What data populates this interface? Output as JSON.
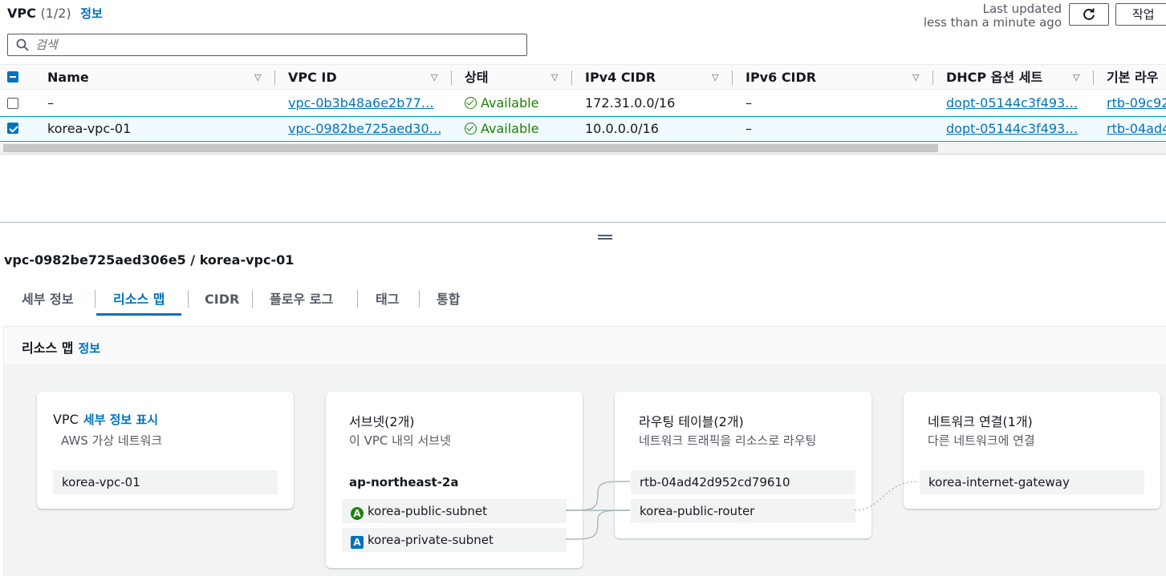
{
  "header": {
    "title": "VPC",
    "count": "(1/2)",
    "info_link": "정보",
    "last_updated_label": "Last updated",
    "last_updated_value": "less than a minute ago",
    "action_label": "작업",
    "refresh_icon": "refresh-icon"
  },
  "search": {
    "placeholder": "검색",
    "icon": "search-icon"
  },
  "table": {
    "columns": [
      "Name",
      "VPC ID",
      "상태",
      "IPv4 CIDR",
      "IPv6 CIDR",
      "DHCP 옵션 세트",
      "기본 라우"
    ],
    "rows": [
      {
        "selected": false,
        "name": "–",
        "vpc_id": "vpc-0b3b48a6e2b77…",
        "status": "Available",
        "ipv4": "172.31.0.0/16",
        "ipv6": "–",
        "dhcp": "dopt-05144c3f493…",
        "route": "rtb-09c92"
      },
      {
        "selected": true,
        "name": "korea-vpc-01",
        "vpc_id": "vpc-0982be725aed30…",
        "status": "Available",
        "ipv4": "10.0.0.0/16",
        "ipv6": "–",
        "dhcp": "dopt-05144c3f493…",
        "route": "rtb-04ad4"
      }
    ]
  },
  "detail": {
    "title": "vpc-0982be725aed306e5 / korea-vpc-01",
    "tabs": [
      "세부 정보",
      "리소스 맵",
      "CIDR",
      "플로우 로그",
      "태그",
      "통합"
    ],
    "active_tab": "리소스 맵"
  },
  "resource_map": {
    "title": "리소스 맵",
    "info_link": "정보",
    "vpc_card": {
      "title": "VPC",
      "link": "세부 정보 표시",
      "subtitle": "AWS 가상 네트워크",
      "items": [
        "korea-vpc-01"
      ]
    },
    "subnet_card": {
      "title": "서브넷(2개)",
      "subtitle": "이 VPC 내의 서브넷",
      "az": "ap-northeast-2a",
      "items": [
        {
          "badge": "A",
          "name": "korea-public-subnet"
        },
        {
          "badge": "A",
          "name": "korea-private-subnet"
        }
      ]
    },
    "route_card": {
      "title": "라우팅 테이블(2개)",
      "subtitle": "네트워크 트래픽을 리소스로 라우팅",
      "items": [
        "rtb-04ad42d952cd79610",
        "korea-public-router"
      ]
    },
    "network_card": {
      "title": "네트워크 연결(1개)",
      "subtitle": "다른 네트워크에 연결",
      "items": [
        "korea-internet-gateway"
      ]
    },
    "colors": {
      "link": "#0073bb",
      "available": "#1d8102",
      "public_badge": "#1d8102",
      "private_badge": "#0073bb"
    }
  }
}
